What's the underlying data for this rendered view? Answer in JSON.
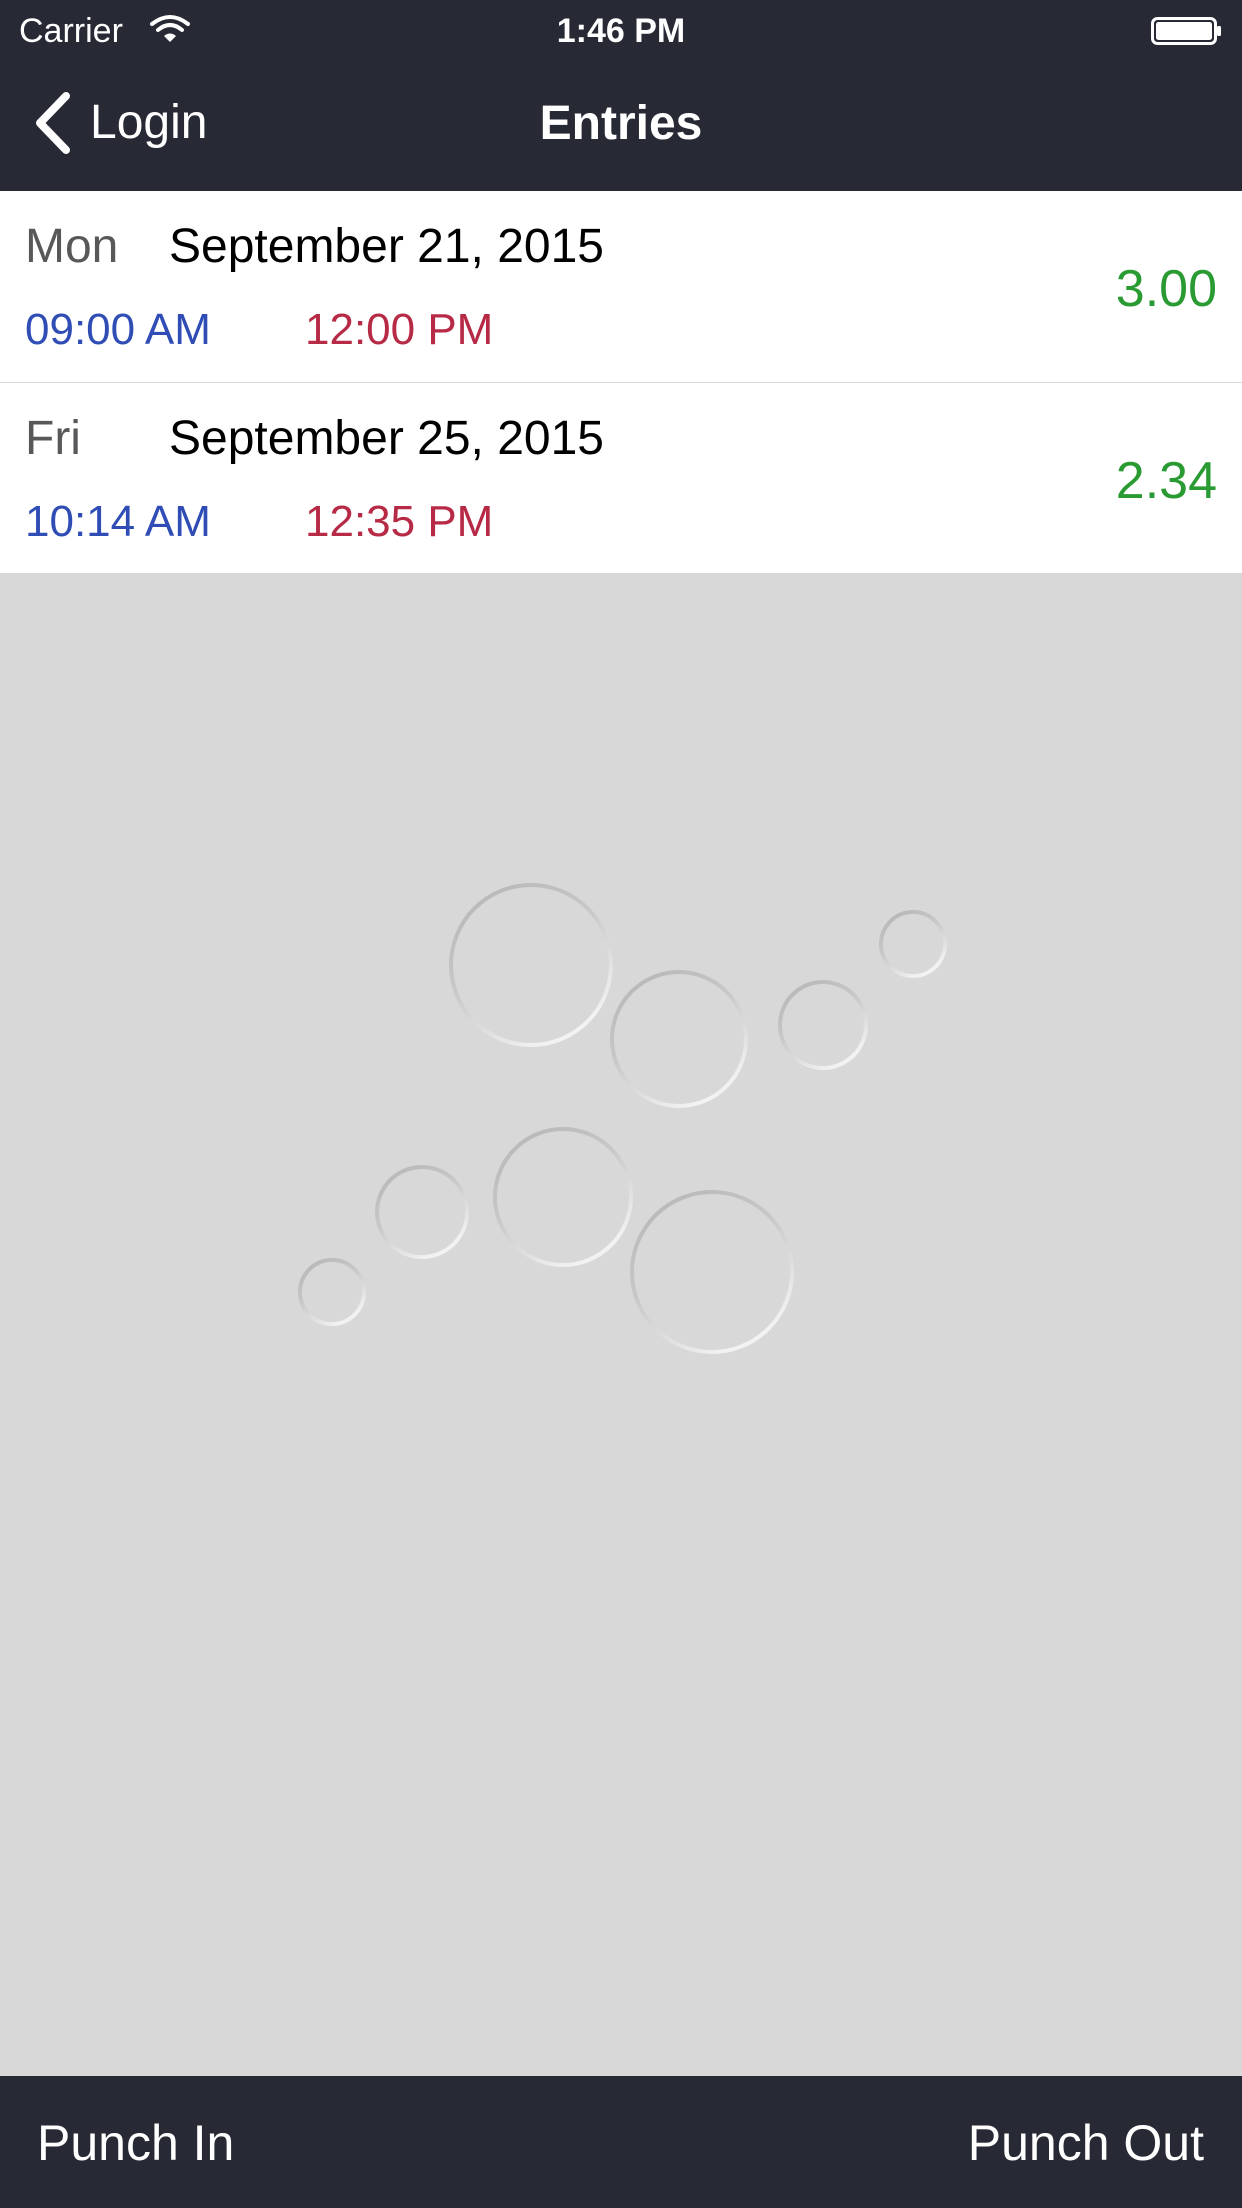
{
  "status_bar": {
    "carrier": "Carrier",
    "time": "1:46 PM",
    "wifi_icon": "wifi-icon",
    "battery_icon": "battery-full-icon"
  },
  "nav": {
    "back_label": "Login",
    "back_icon": "chevron-left-icon",
    "title": "Entries"
  },
  "entries": [
    {
      "day": "Mon",
      "date": "September 21, 2015",
      "time_in": "09:00 AM",
      "time_out": "12:00 PM",
      "hours": "3.00"
    },
    {
      "day": "Fri",
      "date": "September 25, 2015",
      "time_in": "10:14 AM",
      "time_out": "12:35 PM",
      "hours": "2.34"
    }
  ],
  "toolbar": {
    "punch_in_label": "Punch In",
    "punch_out_label": "Punch Out"
  },
  "colors": {
    "bar_background": "#272a35",
    "list_background": "#ffffff",
    "empty_background": "#d8d8d8",
    "day_text": "#58585a",
    "time_in": "#2f4db5",
    "time_out": "#b72a45",
    "hours": "#2a9b33"
  }
}
